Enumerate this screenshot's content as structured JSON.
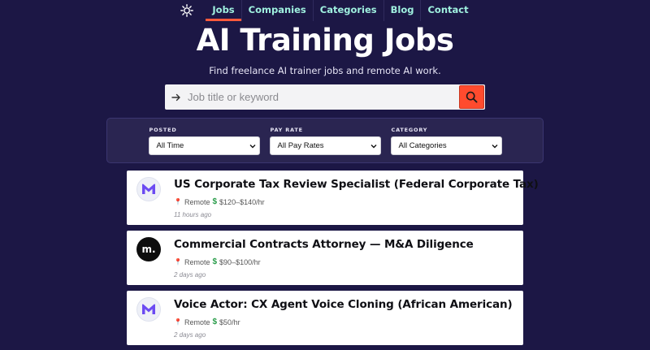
{
  "nav": {
    "logo_icon": "sun-gear-icon",
    "links": [
      {
        "label": "Jobs",
        "active": true
      },
      {
        "label": "Companies",
        "active": false
      },
      {
        "label": "Categories",
        "active": false
      },
      {
        "label": "Blog",
        "active": false
      },
      {
        "label": "Contact",
        "active": false
      }
    ]
  },
  "hero": {
    "title": "AI Training Jobs",
    "subtitle": "Find freelance AI trainer jobs and remote AI work."
  },
  "search": {
    "placeholder": "Job title or keyword",
    "value": ""
  },
  "filters": [
    {
      "label": "POSTED",
      "selected": "All Time"
    },
    {
      "label": "PAY RATE",
      "selected": "All Pay Rates"
    },
    {
      "label": "CATEGORY",
      "selected": "All Categories"
    }
  ],
  "jobs": [
    {
      "logo": "m-logo",
      "title": "US Corporate Tax Review Specialist (Federal Corporate Tax)",
      "location": "Remote",
      "pay": "$120–$140/hr",
      "posted": "11 hours ago"
    },
    {
      "logo": "dot-logo",
      "logo_text": "m.",
      "title": "Commercial Contracts Attorney — M&A Diligence",
      "location": "Remote",
      "pay": "$90–$100/hr",
      "posted": "2 days ago"
    },
    {
      "logo": "m-logo",
      "title": "Voice Actor: CX Agent Voice Cloning (African American)",
      "location": "Remote",
      "pay": "$50/hr",
      "posted": "2 days ago"
    }
  ],
  "colors": {
    "background": "#1c1745",
    "nav_link": "#9ff0df",
    "accent": "#ff4b2e",
    "logo_purple": "#6c4bf2"
  }
}
